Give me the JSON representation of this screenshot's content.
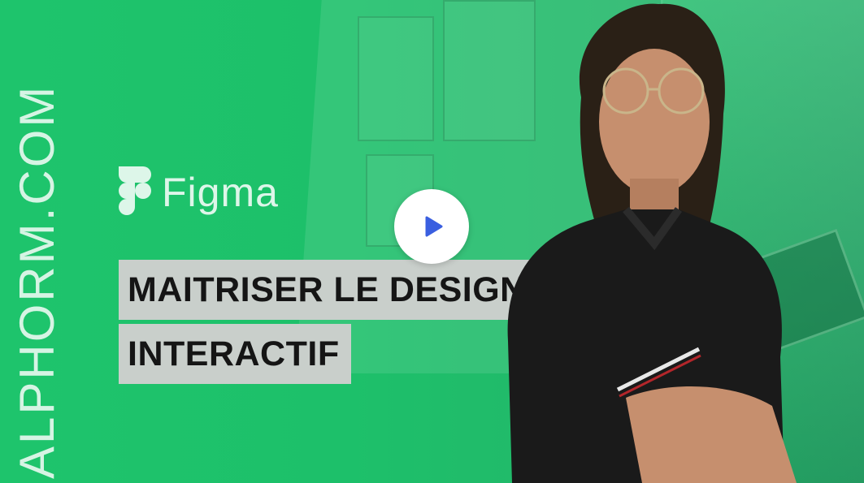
{
  "brand": {
    "vertical_text": "ALPHORM.COM"
  },
  "logo": {
    "icon": "figma-icon",
    "wordmark": "Figma"
  },
  "title": {
    "line1": "MAITRISER LE DESIGN",
    "line2": "INTERACTIF"
  },
  "player": {
    "icon": "play-icon"
  },
  "colors": {
    "background_green": "#1ec46c",
    "title_box": "#c9cfcb",
    "title_text": "#151515",
    "play_triangle": "#3a5fe0"
  }
}
